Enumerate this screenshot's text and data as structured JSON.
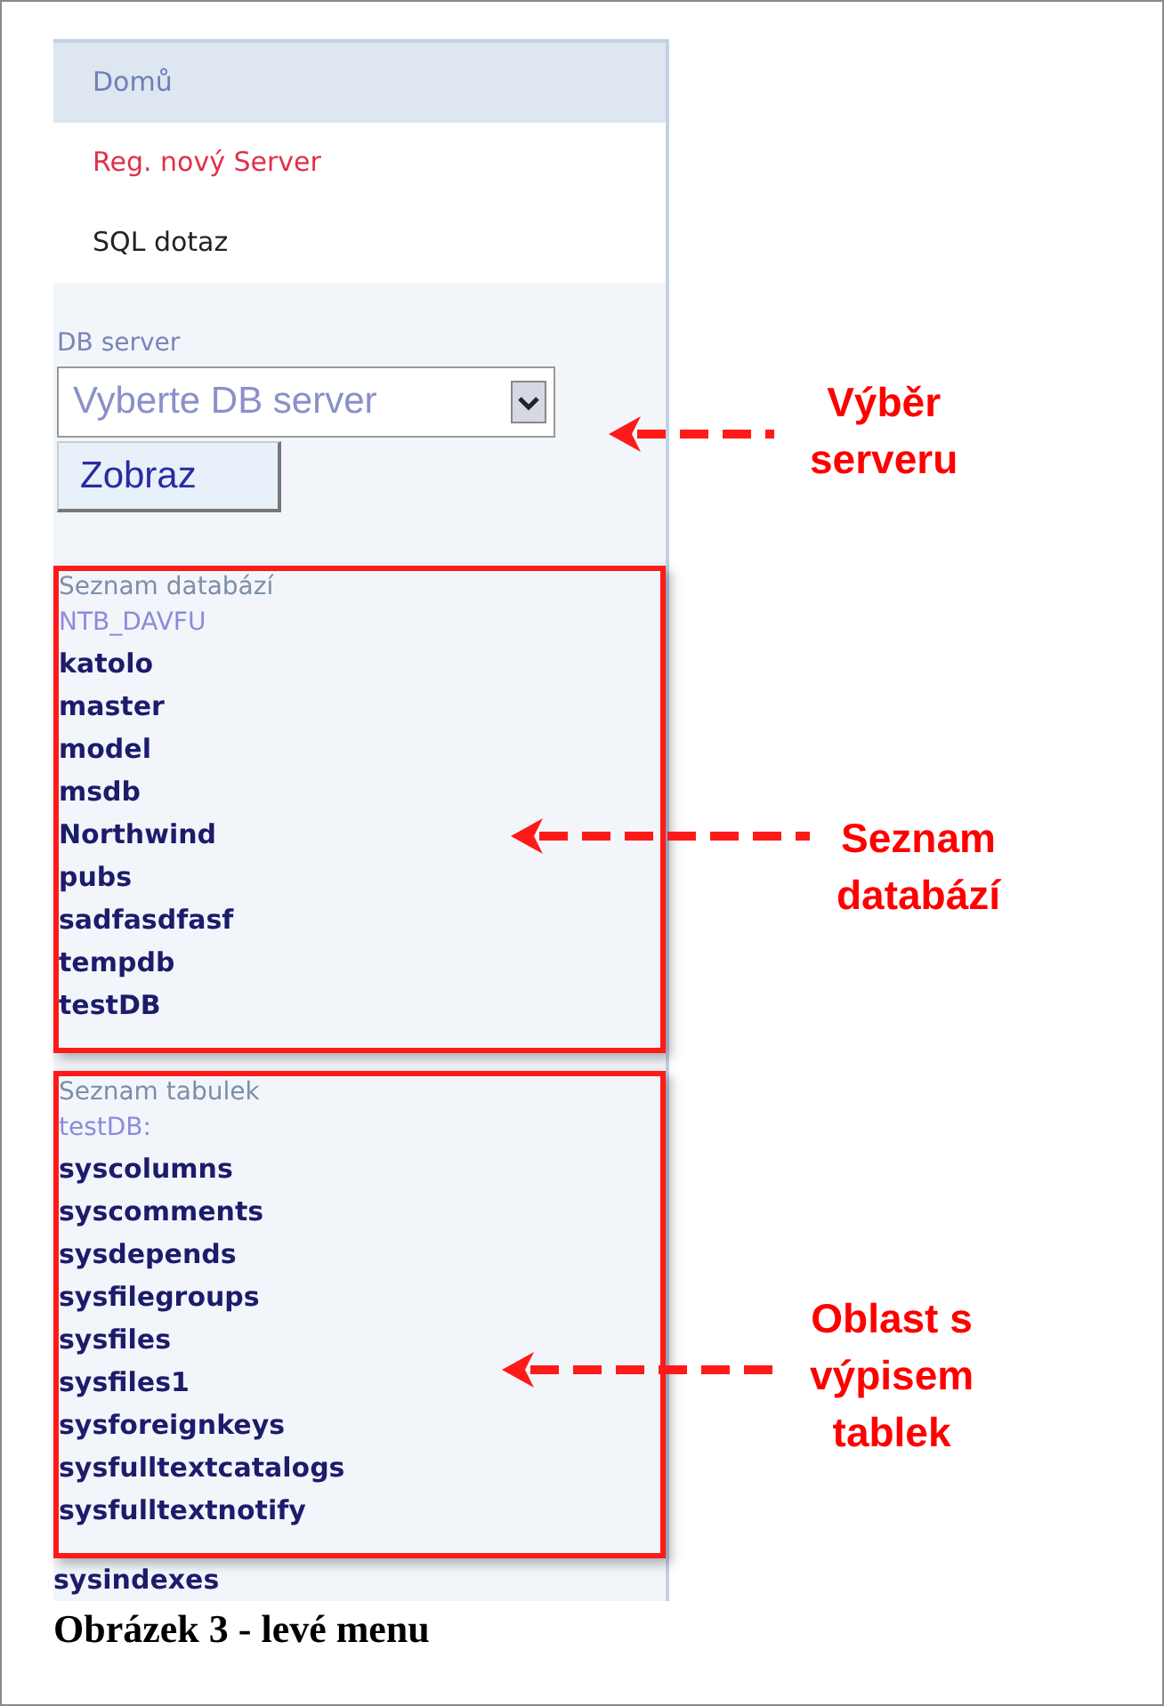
{
  "menu": [
    {
      "label": "Domů",
      "selected": true,
      "highlighted": false
    },
    {
      "label": "Reg. nový Server",
      "selected": false,
      "highlighted": true
    },
    {
      "label": "SQL dotaz",
      "selected": false,
      "highlighted": false
    }
  ],
  "server": {
    "label": "DB server",
    "value": "Vyberte DB server",
    "button": "Zobraz"
  },
  "databases": {
    "title": "Seznam databází",
    "server_name": "NTB_DAVFU",
    "items": [
      {
        "name": "katolo",
        "in_frame": true
      },
      {
        "name": "master",
        "in_frame": true
      },
      {
        "name": "model",
        "in_frame": true
      },
      {
        "name": "msdb",
        "in_frame": true
      },
      {
        "name": "Northwind",
        "in_frame": true
      },
      {
        "name": "pubs",
        "in_frame": true
      },
      {
        "name": "sadfasdfasf",
        "in_frame": true
      },
      {
        "name": "tempdb",
        "in_frame": true
      },
      {
        "name": "testDB",
        "in_frame": true
      }
    ]
  },
  "tables": {
    "title": "Seznam tabulek",
    "db_name": "testDB:",
    "items": [
      {
        "name": "syscolumns",
        "in_frame": true
      },
      {
        "name": "syscomments",
        "in_frame": true
      },
      {
        "name": "sysdepends",
        "in_frame": true
      },
      {
        "name": "sysfilegroups",
        "in_frame": true
      },
      {
        "name": "sysfiles",
        "in_frame": true
      },
      {
        "name": "sysfiles1",
        "in_frame": true
      },
      {
        "name": "sysforeignkeys",
        "in_frame": true
      },
      {
        "name": "sysfulltextcatalogs",
        "in_frame": true
      },
      {
        "name": "sysfulltextnotify",
        "in_frame": true
      },
      {
        "name": "sysindexes",
        "in_frame": false
      }
    ]
  },
  "annotations": [
    {
      "lines": [
        "Výběr",
        "serveru"
      ]
    },
    {
      "lines": [
        "Seznam",
        "databází"
      ]
    },
    {
      "lines": [
        "Oblast s",
        "výpisem",
        "tablek"
      ]
    }
  ],
  "caption": "Obrázek 3 - levé menu"
}
